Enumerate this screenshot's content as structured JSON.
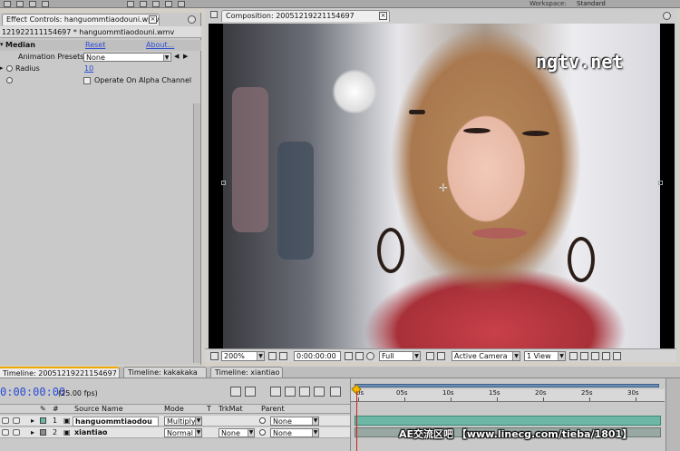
{
  "workspace": {
    "label": "Workspace:",
    "value": "Standard"
  },
  "effect_controls": {
    "tab_label": "Effect Controls: hanguommtiaodouni.wmv",
    "path": "121922111154697 * hanguommtiaodouni.wmv",
    "effect": {
      "name": "Median",
      "reset": "Reset",
      "about": "About..."
    },
    "presets": {
      "label": "Animation Presets:",
      "value": "None"
    },
    "radius": {
      "label": "Radius",
      "value": "10"
    },
    "alpha": {
      "label": "Operate On Alpha Channel"
    }
  },
  "composition": {
    "tab_label": "Composition: 20051219221154697",
    "watermark": "ngtv.net",
    "footer": {
      "zoom": "200%",
      "timecode": "0:00:00:00",
      "resolution": "Full",
      "camera": "Active Camera",
      "view": "1 View"
    }
  },
  "timeline": {
    "tabs": [
      {
        "label": "Timeline: 20051219221154697"
      },
      {
        "label": "Timeline: kakakaka"
      },
      {
        "label": "Timeline: xiantiao"
      }
    ],
    "timecode": "0:00:00:00",
    "fps": "(25.00 fps)",
    "columns": {
      "num": "#",
      "source": "Source Name",
      "mode": "Mode",
      "t": "T",
      "trkmat": "TrkMat",
      "parent": "Parent"
    },
    "layers": [
      {
        "num": "1",
        "name": "hanguommtiaodou",
        "mode": "Multiply",
        "trkmat": "",
        "parent": "None",
        "color": "#6db7a6"
      },
      {
        "num": "2",
        "name": "xiantiao",
        "mode": "Normal",
        "trkmat": "None",
        "parent": "None",
        "color": "#8c8c8c"
      }
    ],
    "ruler": [
      "0s",
      "05s",
      "10s",
      "15s",
      "20s",
      "25s",
      "30s"
    ]
  },
  "overlay": {
    "text": "AE交流区吧 【www.linecg.com/tieba/1801】"
  }
}
